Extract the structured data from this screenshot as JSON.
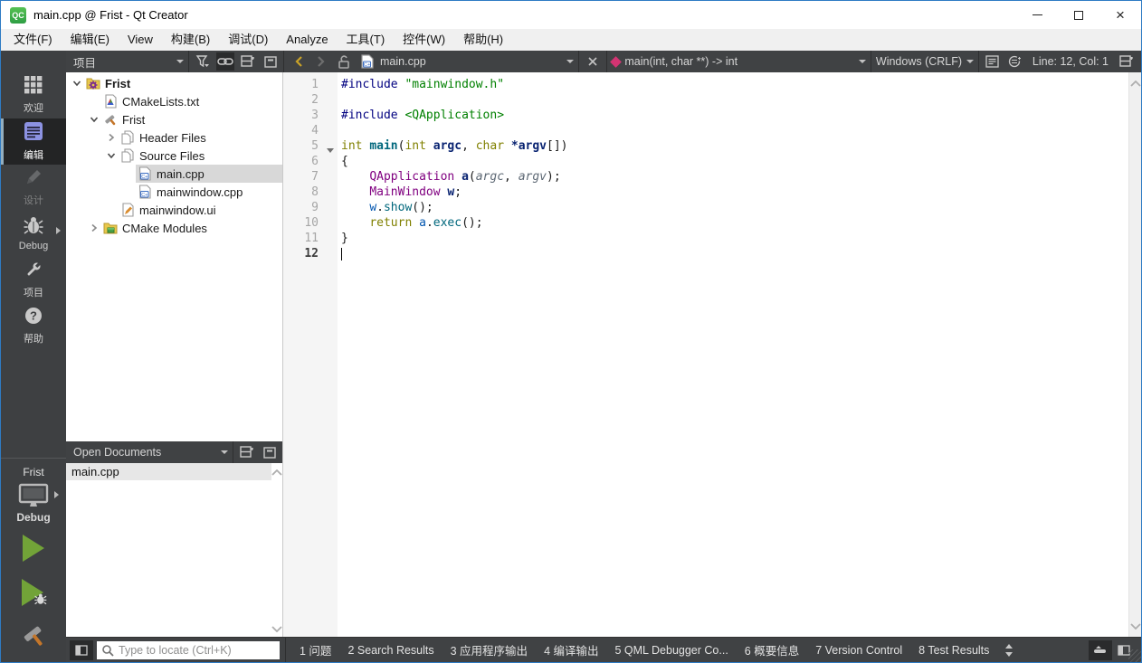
{
  "titlebar": {
    "logo": "QC",
    "title": "main.cpp @ Frist - Qt Creator"
  },
  "menubar": {
    "items": [
      "文件(F)",
      "编辑(E)",
      "View",
      "构建(B)",
      "调试(D)",
      "Analyze",
      "工具(T)",
      "控件(W)",
      "帮助(H)"
    ]
  },
  "modebar": {
    "modes": [
      {
        "label": "欢迎",
        "icon": "grid",
        "selected": false,
        "disabled": false,
        "arrow": false
      },
      {
        "label": "编辑",
        "icon": "editdoc",
        "selected": true,
        "disabled": false,
        "arrow": false
      },
      {
        "label": "设计",
        "icon": "pencil",
        "selected": false,
        "disabled": true,
        "arrow": false
      },
      {
        "label": "Debug",
        "icon": "bug",
        "selected": false,
        "disabled": false,
        "arrow": true
      },
      {
        "label": "项目",
        "icon": "wrench",
        "selected": false,
        "disabled": false,
        "arrow": false
      },
      {
        "label": "帮助",
        "icon": "help",
        "selected": false,
        "disabled": false,
        "arrow": false
      }
    ],
    "kit": {
      "project": "Frist",
      "config": "Debug"
    }
  },
  "project_panel": {
    "title": "项目",
    "tree": [
      {
        "label": "Frist",
        "icon": "projfolder",
        "depth": 0,
        "exp": "down",
        "sel": false,
        "bold": true
      },
      {
        "label": "CMakeLists.txt",
        "icon": "cmakefile",
        "depth": 1,
        "exp": "none",
        "sel": false,
        "bold": false
      },
      {
        "label": "Frist",
        "icon": "hammer14",
        "depth": 1,
        "exp": "down",
        "sel": false,
        "bold": false
      },
      {
        "label": "Header Files",
        "icon": "pages",
        "depth": 2,
        "exp": "right",
        "sel": false,
        "bold": false
      },
      {
        "label": "Source Files",
        "icon": "pages",
        "depth": 2,
        "exp": "down",
        "sel": false,
        "bold": false
      },
      {
        "label": "main.cpp",
        "icon": "cppfile",
        "depth": 3,
        "exp": "none",
        "sel": true,
        "bold": false
      },
      {
        "label": "mainwindow.cpp",
        "icon": "cppfile",
        "depth": 3,
        "exp": "none",
        "sel": false,
        "bold": false
      },
      {
        "label": "mainwindow.ui",
        "icon": "uifile",
        "depth": 2,
        "exp": "none",
        "sel": false,
        "bold": false
      },
      {
        "label": "CMake Modules",
        "icon": "modfolder",
        "depth": 1,
        "exp": "right",
        "sel": false,
        "bold": false
      }
    ]
  },
  "open_documents": {
    "title": "Open Documents",
    "items": [
      "main.cpp"
    ]
  },
  "editor": {
    "toolbar": {
      "file_name": "main.cpp",
      "symbol": "main(int, char **) -> int",
      "line_ending": "Windows (CRLF)",
      "cursor_position": "Line: 12, Col: 1"
    },
    "code_lines": [
      {
        "n": "1",
        "fold": false,
        "cursor": false,
        "segs": [
          [
            "pp",
            "#include"
          ],
          [
            "pl",
            " "
          ],
          [
            "str",
            "\"mainwindow.h\""
          ]
        ]
      },
      {
        "n": "2",
        "fold": false,
        "cursor": false,
        "segs": []
      },
      {
        "n": "3",
        "fold": false,
        "cursor": false,
        "segs": [
          [
            "pp",
            "#include"
          ],
          [
            "pl",
            " "
          ],
          [
            "str",
            "<QApplication>"
          ]
        ]
      },
      {
        "n": "4",
        "fold": false,
        "cursor": false,
        "segs": []
      },
      {
        "n": "5",
        "fold": true,
        "cursor": false,
        "segs": [
          [
            "kw",
            "int"
          ],
          [
            "pl",
            " "
          ],
          [
            "fnb",
            "main"
          ],
          [
            "pl",
            "("
          ],
          [
            "kw",
            "int"
          ],
          [
            "pl",
            " "
          ],
          [
            "dcl",
            "argc"
          ],
          [
            "pl",
            ", "
          ],
          [
            "kw",
            "char"
          ],
          [
            "pl",
            " "
          ],
          [
            "dcl",
            "*argv"
          ],
          [
            "pl",
            "[])"
          ]
        ]
      },
      {
        "n": "6",
        "fold": false,
        "cursor": false,
        "segs": [
          [
            "pl",
            "{"
          ]
        ]
      },
      {
        "n": "7",
        "fold": false,
        "cursor": false,
        "segs": [
          [
            "pl",
            "    "
          ],
          [
            "type",
            "QApplication"
          ],
          [
            "pl",
            " "
          ],
          [
            "dcl",
            "a"
          ],
          [
            "pl",
            "("
          ],
          [
            "prm",
            "argc"
          ],
          [
            "pl",
            ", "
          ],
          [
            "prm",
            "argv"
          ],
          [
            "pl",
            ");"
          ]
        ]
      },
      {
        "n": "8",
        "fold": false,
        "cursor": false,
        "segs": [
          [
            "pl",
            "    "
          ],
          [
            "type",
            "MainWindow"
          ],
          [
            "pl",
            " "
          ],
          [
            "dcl",
            "w"
          ],
          [
            "pl",
            ";"
          ]
        ]
      },
      {
        "n": "9",
        "fold": false,
        "cursor": false,
        "segs": [
          [
            "pl",
            "    "
          ],
          [
            "var",
            "w"
          ],
          [
            "pl",
            "."
          ],
          [
            "fn",
            "show"
          ],
          [
            "pl",
            "();"
          ]
        ]
      },
      {
        "n": "10",
        "fold": false,
        "cursor": false,
        "segs": [
          [
            "pl",
            "    "
          ],
          [
            "kw",
            "return"
          ],
          [
            "pl",
            " "
          ],
          [
            "var",
            "a"
          ],
          [
            "pl",
            "."
          ],
          [
            "fn",
            "exec"
          ],
          [
            "pl",
            "();"
          ]
        ]
      },
      {
        "n": "11",
        "fold": false,
        "cursor": false,
        "segs": [
          [
            "pl",
            "}"
          ]
        ]
      },
      {
        "n": "12",
        "fold": false,
        "cursor": true,
        "segs": []
      }
    ]
  },
  "statusbar": {
    "locator_placeholder": "Type to locate (Ctrl+K)",
    "output_panes": [
      {
        "key": "1",
        "label": "问题"
      },
      {
        "key": "2",
        "label": "Search Results"
      },
      {
        "key": "3",
        "label": "应用程序输出"
      },
      {
        "key": "4",
        "label": "编译输出"
      },
      {
        "key": "5",
        "label": "QML Debugger Co..."
      },
      {
        "key": "6",
        "label": "概要信息"
      },
      {
        "key": "7",
        "label": "Version Control"
      },
      {
        "key": "8",
        "label": "Test Results"
      }
    ]
  },
  "colors": {
    "accent_border": "#2e7bc4",
    "dark_chrome": "#404244",
    "run_green": "#72a338",
    "symbol_diamond": "#d23472",
    "logo_green": "#2f9e44"
  }
}
